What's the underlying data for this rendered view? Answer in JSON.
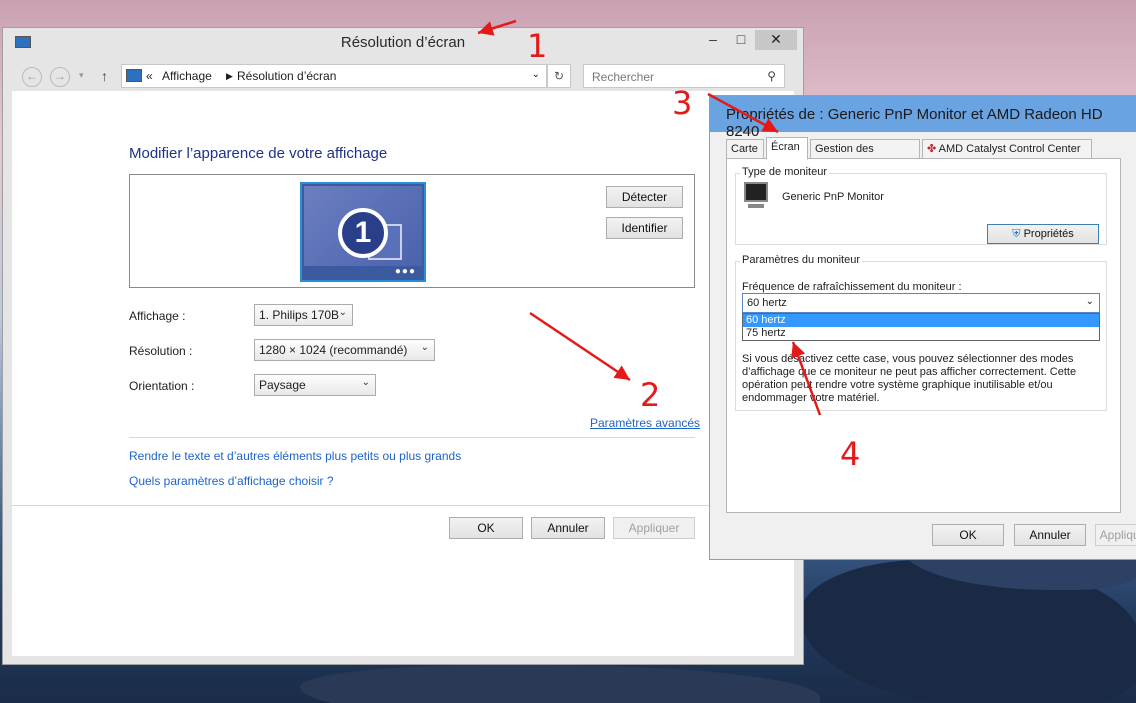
{
  "window1": {
    "title": "Résolution d’écran",
    "breadcrumb": {
      "sep": "«",
      "parent": "Affichage",
      "current": "Résolution d’écran"
    },
    "search_placeholder": "Rechercher",
    "heading": "Modifier l’apparence de votre affichage",
    "monitor_number": "1",
    "detect_button": "Détecter",
    "identify_button": "Identifier",
    "display_label": "Affichage :",
    "display_value": "1. Philips 170B",
    "resolution_label": "Résolution :",
    "resolution_value": "1280 × 1024 (recommandé)",
    "orientation_label": "Orientation :",
    "orientation_value": "Paysage",
    "advanced_link": "Paramètres avancés",
    "text_size_link": "Rendre le texte et d’autres éléments plus petits ou plus grands",
    "which_settings_link": "Quels paramètres d’affichage choisir ?",
    "ok_button": "OK",
    "cancel_button": "Annuler",
    "apply_button": "Appliquer"
  },
  "window2": {
    "title": "Propriétés de : Generic PnP Monitor et AMD Radeon HD 8240",
    "tabs": [
      "Carte",
      "Écran",
      "Gestion des couleurs",
      "AMD Catalyst Control Center"
    ],
    "monitor_type_group": "Type de moniteur",
    "monitor_name": "Generic PnP Monitor",
    "properties_button": "Propriétés",
    "monitor_settings_group": "Paramètres du moniteur",
    "refresh_label": "Fréquence de rafraîchissement du moniteur :",
    "refresh_selected": "60 hertz",
    "refresh_options": [
      "60 hertz",
      "75 hertz"
    ],
    "warning_text": "Si vous désactivez cette case, vous pouvez sélectionner des modes d’affichage que ce moniteur ne peut pas afficher correctement. Cette opération peut rendre votre système graphique inutilisable et/ou endommager votre matériel.",
    "ok_button": "OK",
    "cancel_button": "Annuler",
    "apply_button": "Appliquer"
  },
  "annotations": [
    "1",
    "2",
    "3",
    "4"
  ],
  "colors": {
    "annotation": "#e41a1a",
    "link": "#1e64c8",
    "heading": "#1e3287",
    "titlebar2": "#6aa3e2"
  }
}
